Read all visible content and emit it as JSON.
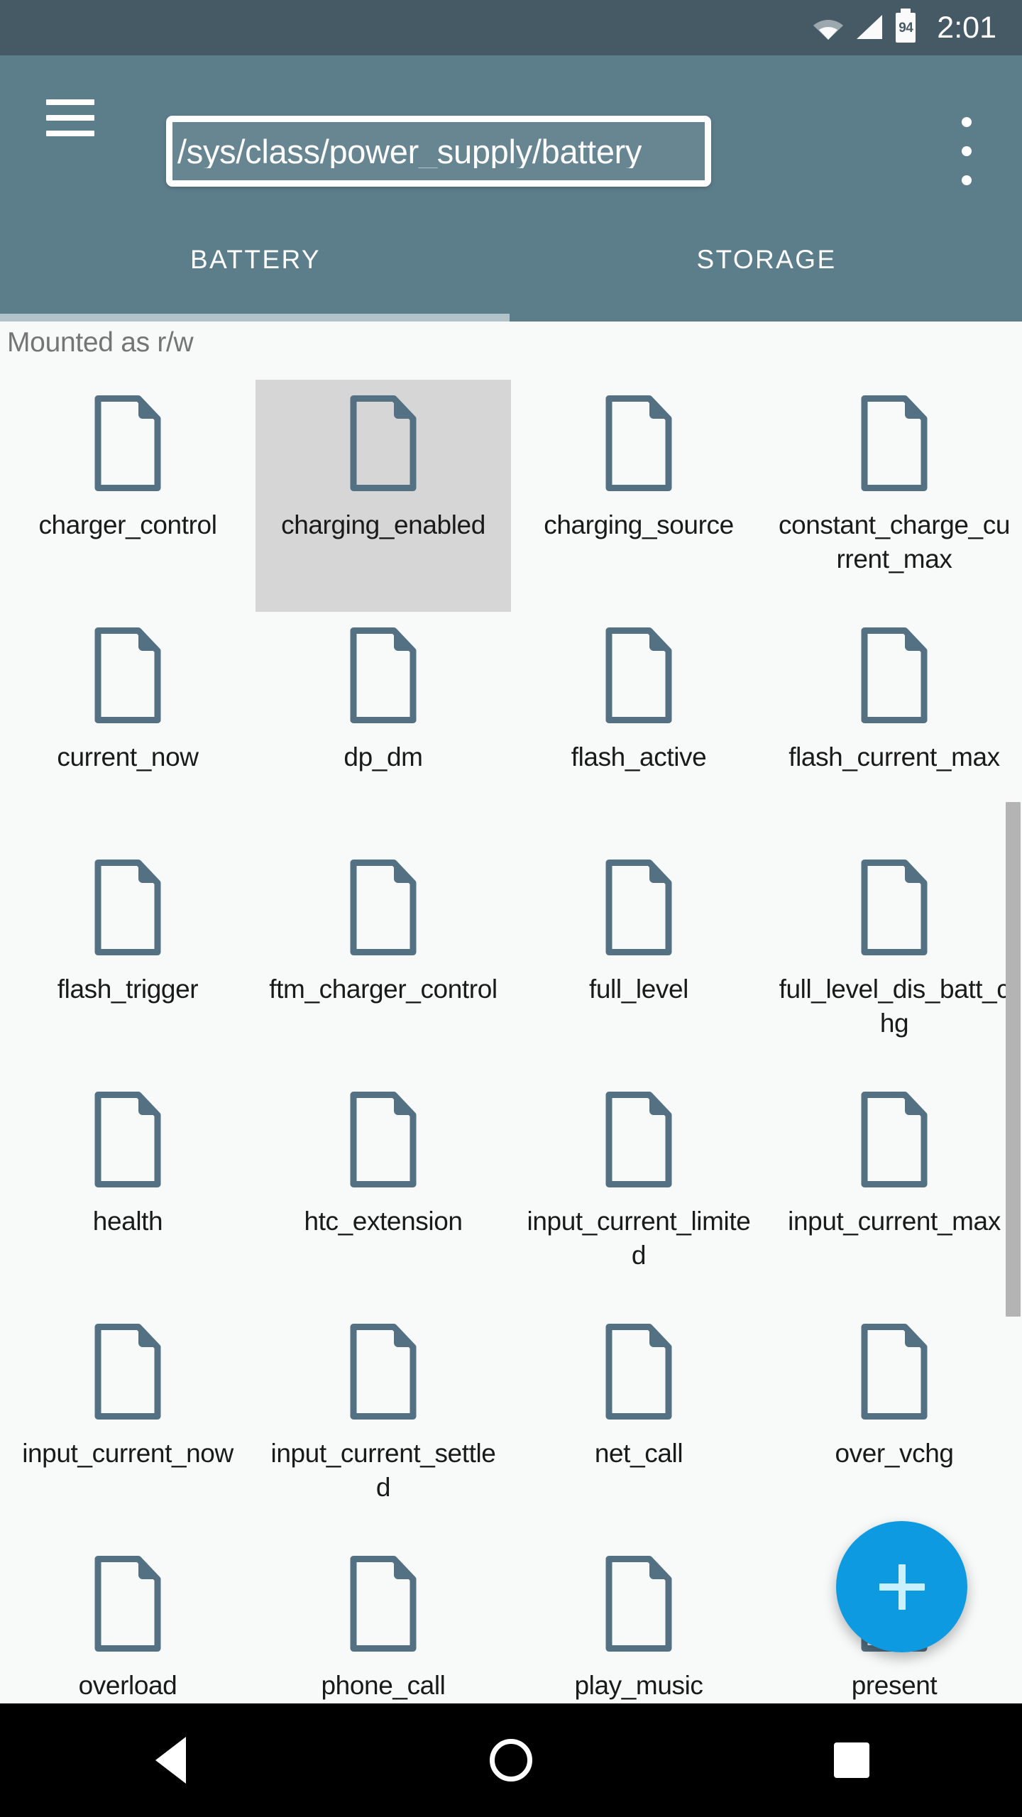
{
  "statusbar": {
    "wifi_icon": "wifi-icon",
    "signal_icon": "signal-icon",
    "battery_icon": "battery-icon",
    "battery_level": "94",
    "time": "2:01"
  },
  "toolbar": {
    "menu_icon": "hamburger-menu-icon",
    "path_value": "/sys/class/power_supply/battery",
    "path_placeholder": "/sys/class/power_supply/battery",
    "overflow_icon": "overflow-menu-icon"
  },
  "tabs": [
    {
      "label": "BATTERY",
      "active": true
    },
    {
      "label": "STORAGE",
      "active": false
    }
  ],
  "content": {
    "mount_status": "Mounted as r/w",
    "files": [
      {
        "name": "charger_control",
        "selected": false
      },
      {
        "name": "charging_enabled",
        "selected": true
      },
      {
        "name": "charging_source",
        "selected": false
      },
      {
        "name": "constant_charge_current_max",
        "selected": false
      },
      {
        "name": "current_now",
        "selected": false
      },
      {
        "name": "dp_dm",
        "selected": false
      },
      {
        "name": "flash_active",
        "selected": false
      },
      {
        "name": "flash_current_max",
        "selected": false
      },
      {
        "name": "flash_trigger",
        "selected": false
      },
      {
        "name": "ftm_charger_control",
        "selected": false
      },
      {
        "name": "full_level",
        "selected": false
      },
      {
        "name": "full_level_dis_batt_chg",
        "selected": false
      },
      {
        "name": "health",
        "selected": false
      },
      {
        "name": "htc_extension",
        "selected": false
      },
      {
        "name": "input_current_limited",
        "selected": false
      },
      {
        "name": "input_current_max",
        "selected": false
      },
      {
        "name": "input_current_now",
        "selected": false
      },
      {
        "name": "input_current_settled",
        "selected": false
      },
      {
        "name": "net_call",
        "selected": false
      },
      {
        "name": "over_vchg",
        "selected": false
      },
      {
        "name": "overload",
        "selected": false
      },
      {
        "name": "phone_call",
        "selected": false
      },
      {
        "name": "play_music",
        "selected": false
      },
      {
        "name": "present",
        "selected": false
      }
    ]
  },
  "fab": {
    "icon": "plus-icon",
    "label": "+"
  },
  "navbar": {
    "back": "back-icon",
    "home": "home-icon",
    "recents": "recents-icon"
  },
  "colors": {
    "statusbar_bg": "#455A64",
    "toolbar_bg": "#5C7D8A",
    "tab_indicator": "#B2C2C9",
    "content_bg": "#F8F9F9",
    "selected_cell": "#D6D6D6",
    "file_icon": "#547083",
    "fab_bg": "#0D9AE0",
    "fab_plus": "#C9F0FF",
    "navbar_bg": "#000000"
  }
}
